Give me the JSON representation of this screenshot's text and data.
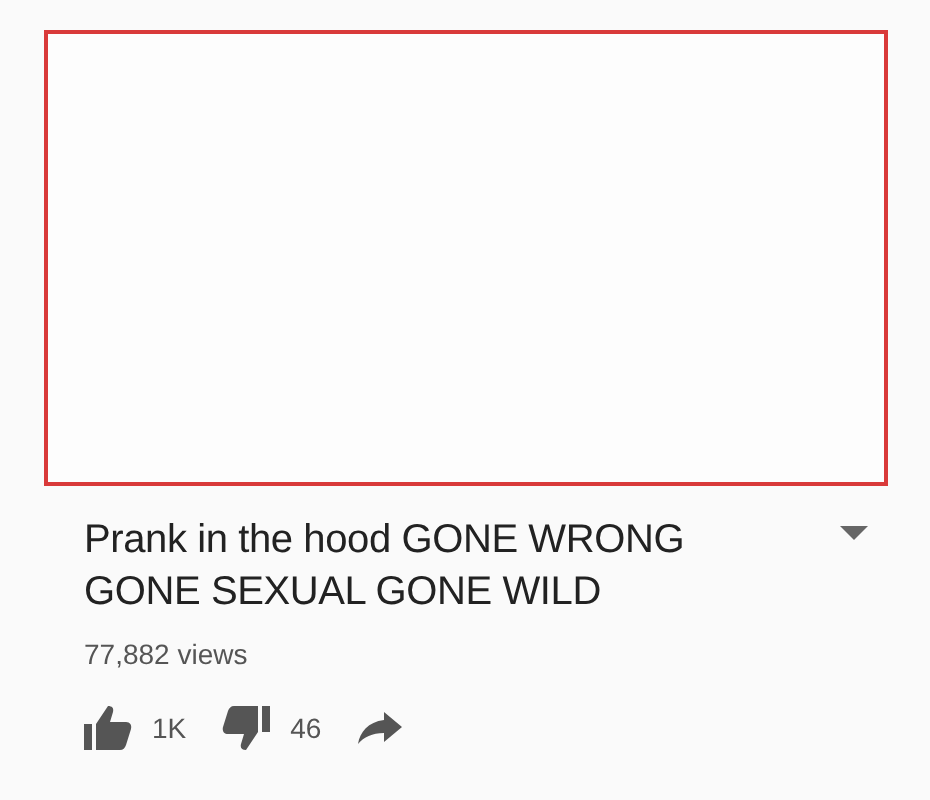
{
  "video": {
    "title": "Prank in the hood GONE WRONG GONE SEXUAL GONE WILD",
    "views": "77,882 views",
    "likes": "1K",
    "dislikes": "46"
  }
}
